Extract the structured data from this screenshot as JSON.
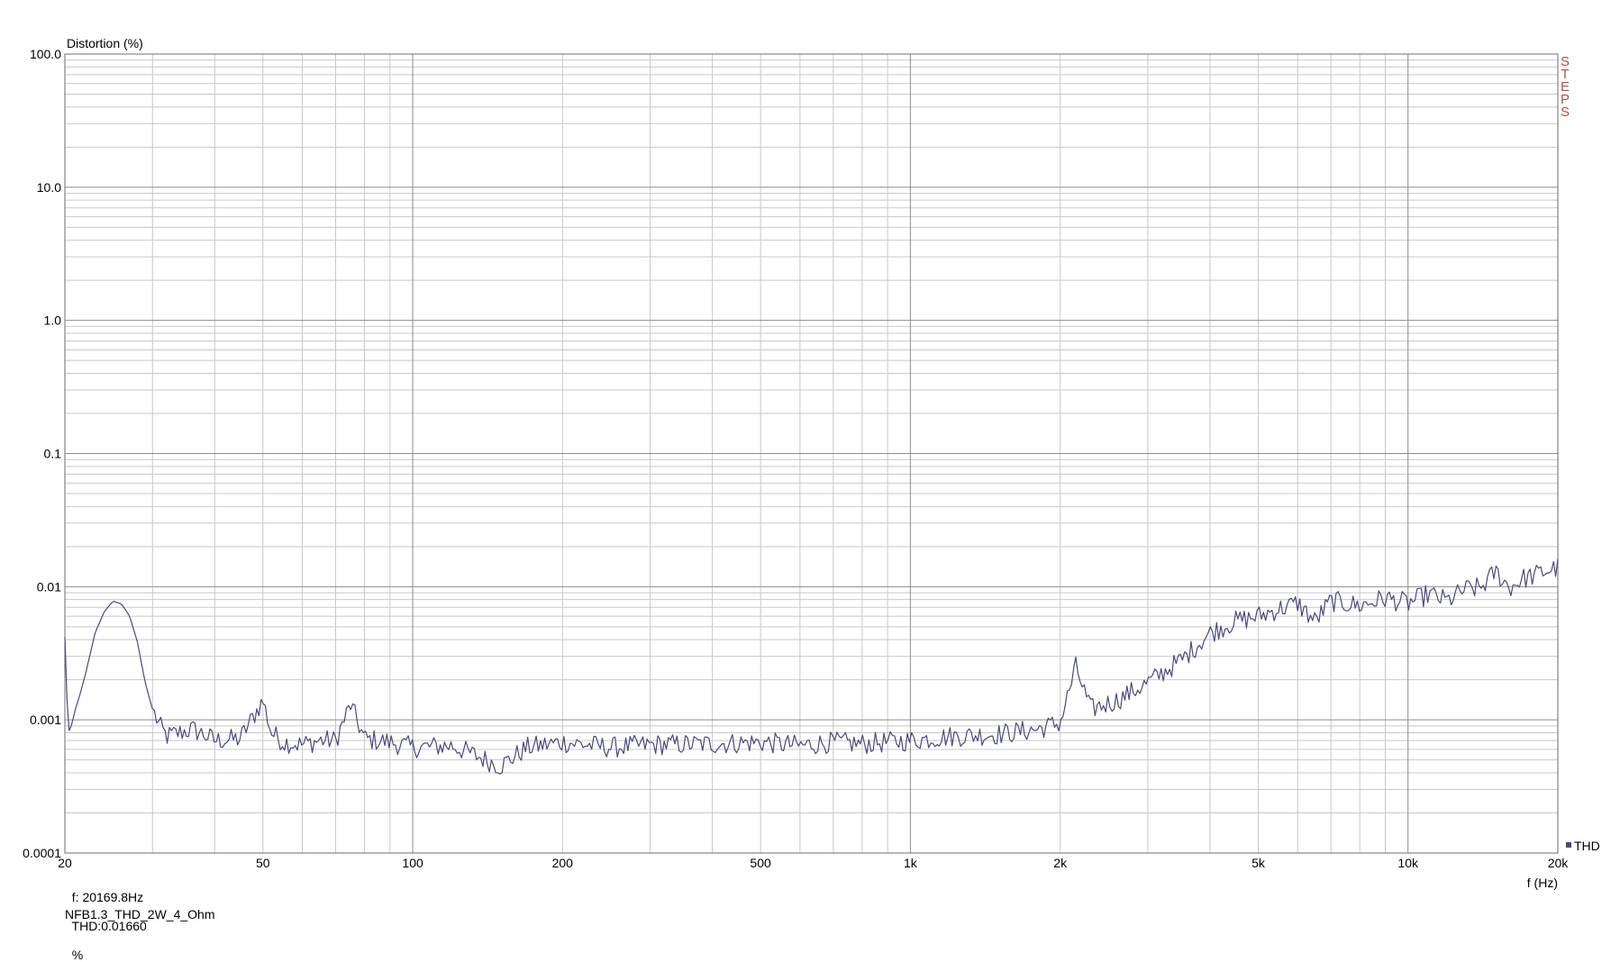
{
  "chart_data": {
    "type": "line",
    "title": "",
    "ylabel": "Distortion (%)",
    "xlabel": "f (Hz)",
    "xscale": "log",
    "yscale": "log",
    "xlim": [
      20,
      20000
    ],
    "ylim": [
      0.0001,
      100
    ],
    "x_ticks": [
      {
        "value": 20,
        "label": "20"
      },
      {
        "value": 50,
        "label": "50"
      },
      {
        "value": 100,
        "label": "100"
      },
      {
        "value": 200,
        "label": "200"
      },
      {
        "value": 500,
        "label": "500"
      },
      {
        "value": 1000,
        "label": "1k"
      },
      {
        "value": 2000,
        "label": "2k"
      },
      {
        "value": 5000,
        "label": "5k"
      },
      {
        "value": 10000,
        "label": "10k"
      },
      {
        "value": 20000,
        "label": "20k"
      }
    ],
    "y_ticks": [
      {
        "value": 100,
        "label": "100.0"
      },
      {
        "value": 10,
        "label": "10.0"
      },
      {
        "value": 1,
        "label": "1.0"
      },
      {
        "value": 0.1,
        "label": "0.1"
      },
      {
        "value": 0.01,
        "label": "0.01"
      },
      {
        "value": 0.001,
        "label": "0.001"
      },
      {
        "value": 0.0001,
        "label": "0.0001"
      }
    ],
    "grid": true,
    "legend": {
      "placement": "right-bottom"
    },
    "series": [
      {
        "name": "THD",
        "color": "#4a4a7a",
        "x": [
          20,
          20.3,
          20.6,
          21,
          21.5,
          22,
          23,
          24,
          25,
          26,
          27,
          28,
          29,
          30,
          31,
          32,
          34,
          36,
          38,
          40,
          45,
          50,
          52,
          55,
          60,
          65,
          70,
          75,
          80,
          90,
          100,
          120,
          150,
          170,
          200,
          250,
          300,
          400,
          500,
          600,
          700,
          800,
          900,
          1000,
          1200,
          1500,
          1800,
          2000,
          2150,
          2300,
          2600,
          3000,
          3500,
          4000,
          4500,
          5000,
          5500,
          6000,
          6500,
          7000,
          8000,
          9000,
          10000,
          11000,
          12000,
          13000,
          14000,
          15000,
          16000,
          17000,
          18000,
          19000,
          20000
        ],
        "y": [
          0.0042,
          0.0008,
          0.0009,
          0.0012,
          0.0016,
          0.0022,
          0.0045,
          0.0065,
          0.0078,
          0.0074,
          0.006,
          0.0038,
          0.0019,
          0.0012,
          0.0009,
          0.00075,
          0.0008,
          0.00085,
          0.00078,
          0.0007,
          0.00072,
          0.0014,
          0.0008,
          0.00068,
          0.00065,
          0.0007,
          0.0007,
          0.0013,
          0.00072,
          0.00068,
          0.00062,
          0.00064,
          0.00045,
          0.00062,
          0.00068,
          0.00062,
          0.00065,
          0.00066,
          0.00068,
          0.00064,
          0.00068,
          0.00066,
          0.00068,
          0.0007,
          0.00075,
          0.00078,
          0.00085,
          0.00095,
          0.0025,
          0.0012,
          0.0014,
          0.0019,
          0.0028,
          0.0045,
          0.0055,
          0.006,
          0.0068,
          0.0075,
          0.0055,
          0.0078,
          0.0072,
          0.0082,
          0.0075,
          0.0088,
          0.0078,
          0.0095,
          0.0098,
          0.013,
          0.0098,
          0.0115,
          0.0122,
          0.0132,
          0.0139
        ]
      }
    ],
    "cursor_readout": {
      "freq": "f: 20169.8Hz",
      "thd": "THD:0.01660",
      "unit": "%"
    },
    "watermark_letters": [
      "S",
      "T",
      "E",
      "P",
      "S"
    ],
    "file_name": "NFB1.3_THD_2W_4_Ohm",
    "colors": {
      "grid_major": "#8c8c8c",
      "grid_minor": "#c8c8c8",
      "frame": "#6e6e6e",
      "line": "#4a4a7a",
      "brand": "#b0504a"
    }
  }
}
